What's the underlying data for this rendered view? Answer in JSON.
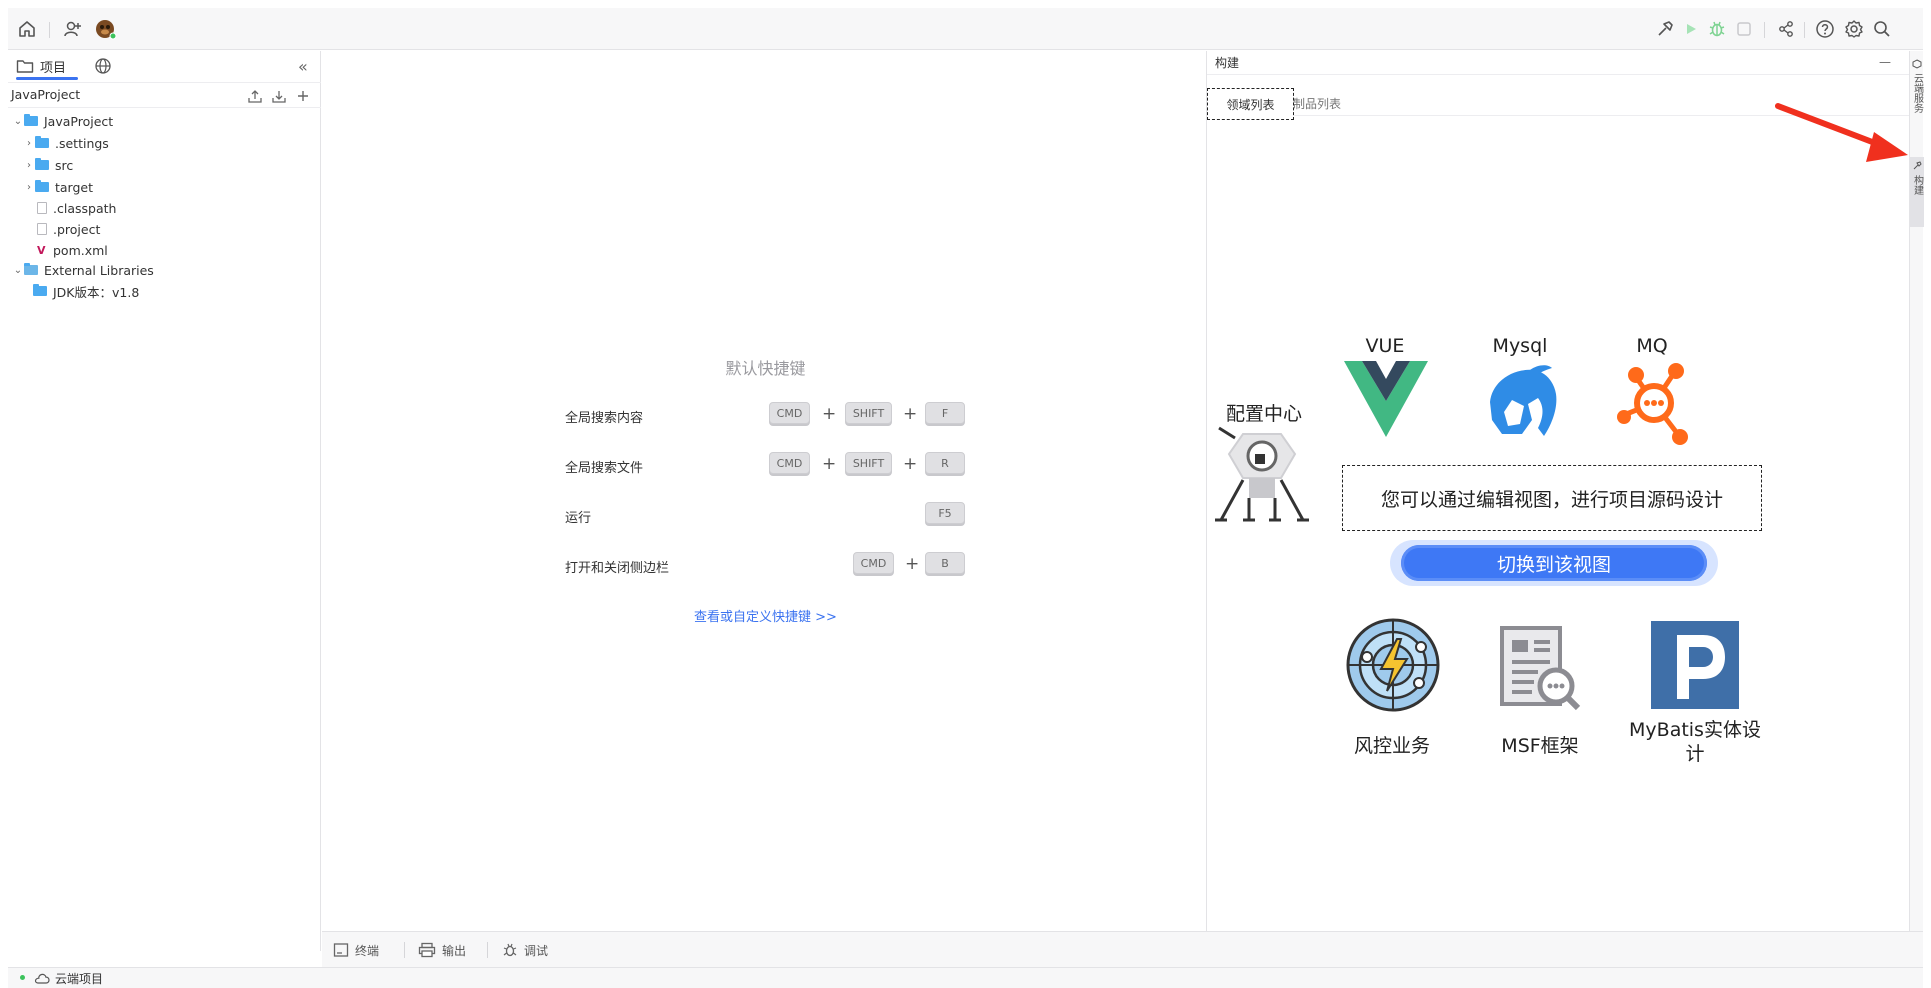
{
  "topbar": {
    "left_icons": [
      "home-icon",
      "add-user-icon",
      "avatar"
    ],
    "right_icons": [
      "hammer-icon",
      "run-icon",
      "debug-icon",
      "stop-icon",
      "share-icon",
      "help-icon",
      "settings-icon",
      "search-icon"
    ]
  },
  "left_panel": {
    "tab_project": "项目",
    "header_title": "JavaProject",
    "tree": [
      {
        "label": "JavaProject",
        "kind": "folder",
        "expanded": true,
        "depth": 0
      },
      {
        "label": ".settings",
        "kind": "folder",
        "expanded": false,
        "depth": 1
      },
      {
        "label": "src",
        "kind": "folder",
        "expanded": false,
        "depth": 1
      },
      {
        "label": "target",
        "kind": "folder",
        "expanded": false,
        "depth": 1
      },
      {
        "label": ".classpath",
        "kind": "file",
        "depth": 1
      },
      {
        "label": ".project",
        "kind": "file",
        "depth": 1
      },
      {
        "label": "pom.xml",
        "kind": "maven",
        "depth": 1
      },
      {
        "label": "External Libraries",
        "kind": "folder",
        "expanded": true,
        "depth": 0
      },
      {
        "label": "JDK版本：v1.8",
        "kind": "folder",
        "depth": 1
      }
    ]
  },
  "editor": {
    "shortcut_title": "默认快捷键",
    "shortcuts": [
      {
        "label": "全局搜索内容",
        "keys": [
          "CMD",
          "SHIFT",
          "F"
        ]
      },
      {
        "label": "全局搜索文件",
        "keys": [
          "CMD",
          "SHIFT",
          "R"
        ]
      },
      {
        "label": "运行",
        "keys": [
          "F5"
        ]
      },
      {
        "label": "打开和关闭侧边栏",
        "keys": [
          "CMD",
          "B"
        ]
      }
    ],
    "plus": "+",
    "link": "查看或自定义快捷键 >>"
  },
  "bottombar": {
    "terminal": "终端",
    "output": "输出",
    "debug": "调试"
  },
  "statusbar": {
    "cloud_project": "云端项目"
  },
  "build_panel": {
    "title": "构建",
    "minimize": "—",
    "tab_domains": "领域列表",
    "tab_products": "制品列表",
    "domains": {
      "config": "配置中心",
      "vue": "VUE",
      "mysql": "Mysql",
      "mq": "MQ",
      "risk": "风控业务",
      "msf": "MSF框架",
      "mybatis": "MyBatis实体设计"
    },
    "notice": "您可以通过编辑视图，进行项目源码设计",
    "switch_button": "切换到该视图"
  },
  "rail": {
    "cloud_service": "云端服务",
    "build": "构建"
  },
  "colors": {
    "accent": "#3b73f0",
    "vue_green": "#41b883",
    "vue_dark": "#34495e",
    "mysql_blue": "#2f8ce6",
    "mq_orange": "#ff6a1a",
    "mybatis_blue": "#3f6fa8",
    "arrow_red": "#f0301e"
  }
}
